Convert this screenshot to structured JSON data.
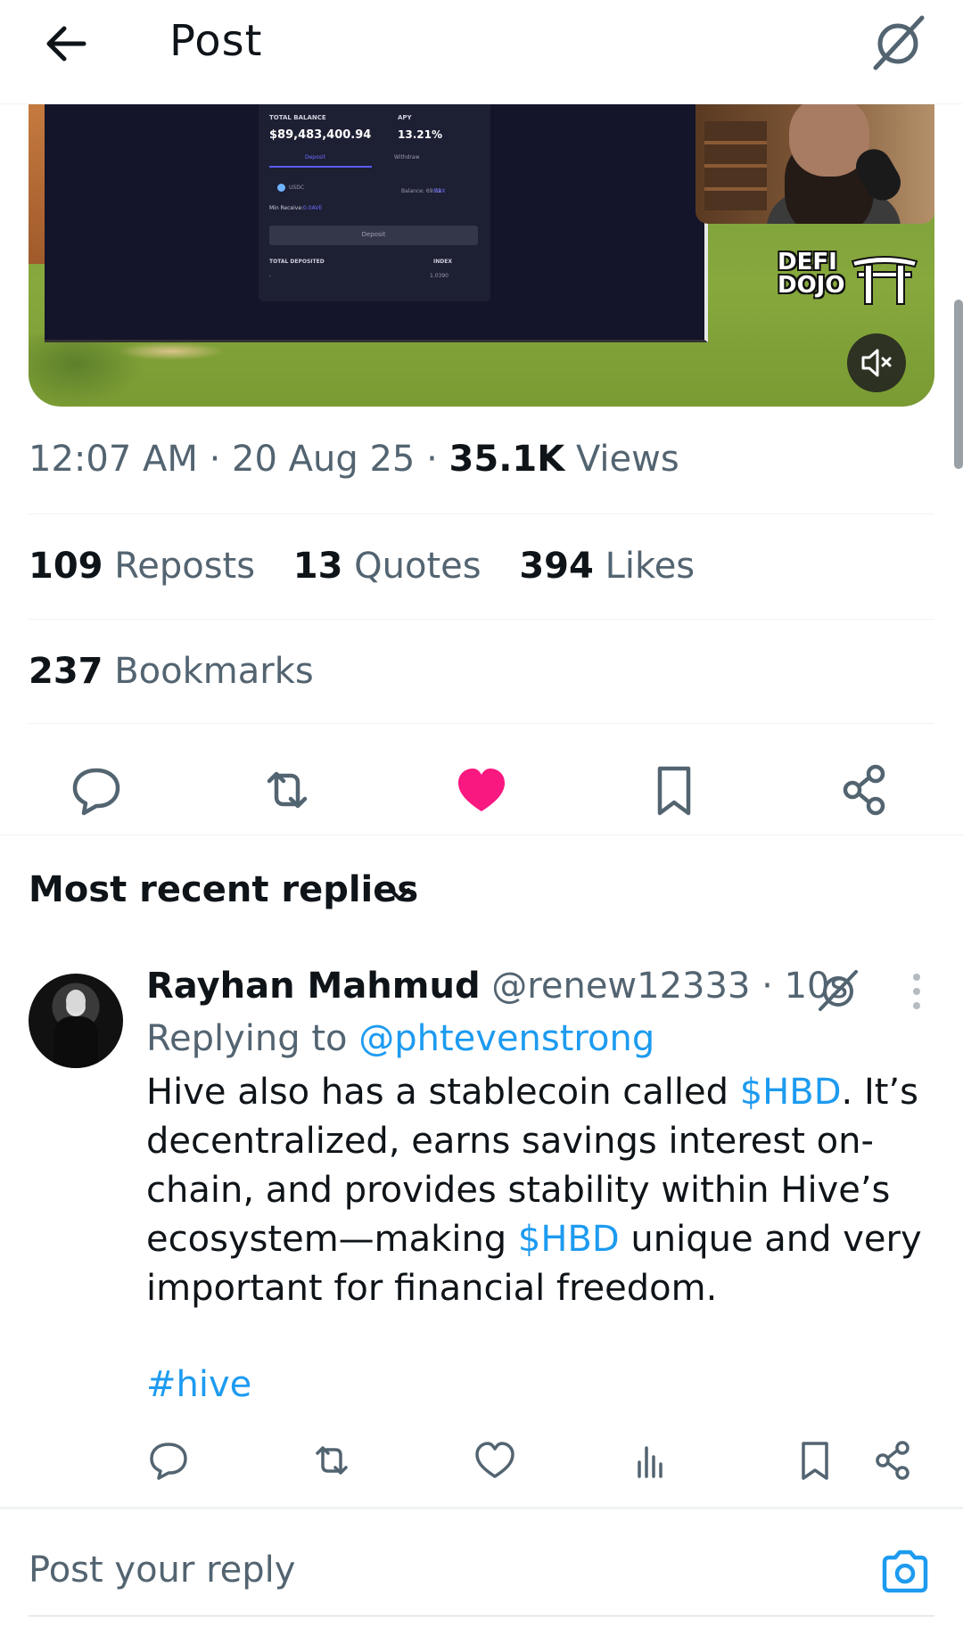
{
  "header": {
    "title": "Post",
    "back_icon": "arrow-left-icon",
    "grok_icon": "grok-icon"
  },
  "media": {
    "panel": {
      "total_balance_label": "TOTAL BALANCE",
      "total_balance_value": "$89,483,400.94",
      "apy_label": "APY",
      "apy_value": "13.21%",
      "tab_deposit": "Deposit",
      "tab_withdraw": "Withdraw",
      "coin": "USDC",
      "balance_text": "Balance: 69.32",
      "balance_max": "MAX",
      "min_receive_label": "Min Receive:",
      "min_receive_value": "0.0AVE",
      "deposit_button": "Deposit",
      "total_deposited_label": "TOTAL DEPOSITED",
      "total_deposited_value": "-",
      "index_label": "INDEX",
      "index_value": "1.0390"
    },
    "logo_line1": "DEFI",
    "logo_line2": "DOJO",
    "mute_icon": "speaker-muted-icon"
  },
  "meta": {
    "time": "12:07 AM",
    "date": "20 Aug 25",
    "views_count": "35.1K",
    "views_label": "Views",
    "separator": " · "
  },
  "stats": {
    "reposts_count": "109",
    "reposts_label": "Reposts",
    "quotes_count": "13",
    "quotes_label": "Quotes",
    "likes_count": "394",
    "likes_label": "Likes",
    "bookmarks_count": "237",
    "bookmarks_label": "Bookmarks"
  },
  "actions": [
    "reply-icon",
    "repost-icon",
    "heart-filled-icon",
    "bookmark-icon",
    "share-icon"
  ],
  "sort": {
    "label": "Most recent replies"
  },
  "reply": {
    "name": "Rayhan Mahmud",
    "handle": "@renew12333",
    "time": "10s",
    "replying_prefix": "Replying to",
    "replying_to": "@phtevenstrong",
    "body_1": "Hive also has a stablecoin called ",
    "cashtag_1": "$HBD",
    "body_2": ". It’s decentralized, earns savings interest on-chain, and provides stability within Hive’s ecosystem—making ",
    "cashtag_2": "$HBD",
    "body_3": " unique and very important for financial freedom.",
    "hashtag": "#hive"
  },
  "compose": {
    "placeholder": "Post your reply",
    "camera_icon": "camera-icon"
  },
  "colors": {
    "accent": "#1d9bf0",
    "like": "#f91880",
    "text": "#0f1419",
    "muted": "#536471"
  }
}
